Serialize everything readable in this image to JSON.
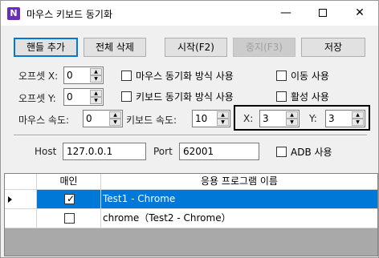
{
  "window": {
    "title": "마우스 키보드 동기화",
    "icon_letter": "N",
    "minimize": "—",
    "close": "✕"
  },
  "toolbar": {
    "add_handle": "핸들 추가",
    "delete_all": "전체 삭제",
    "start": "시작(F2)",
    "stop": "중지(F3)",
    "save": "저장"
  },
  "settings": {
    "offset_x_label": "오프셋 X:",
    "offset_x_value": "0",
    "offset_y_label": "오프셋 Y:",
    "offset_y_value": "0",
    "mouse_speed_label": "마우스 속도:",
    "mouse_speed_value": "0",
    "keyboard_speed_label": "키보드 속도:",
    "keyboard_speed_value": "10",
    "x_label": "X:",
    "x_value": "3",
    "y_label": "Y:",
    "y_value": "3",
    "mouse_sync_label": "마우스 동기화 방식 사용",
    "keyboard_sync_label": "키보드 동기화 방식 사용",
    "move_use_label": "이동 사용",
    "activate_use_label": "활성 사용"
  },
  "connection": {
    "host_label": "Host",
    "host_value": "127.0.0.1",
    "port_label": "Port",
    "port_value": "62001",
    "adb_label": "ADB 사용"
  },
  "grid": {
    "columns": [
      "매인",
      "응용 프로그램 이름"
    ],
    "rows": [
      {
        "main": true,
        "name": "Test1 - Chrome",
        "selected": true
      },
      {
        "main": false,
        "name": "chrome（Test2 - Chrome）",
        "selected": false
      }
    ]
  },
  "colors": {
    "selection": "#0078d7",
    "focus_border": "#0078d7",
    "app_icon": "#6b2fb3"
  }
}
